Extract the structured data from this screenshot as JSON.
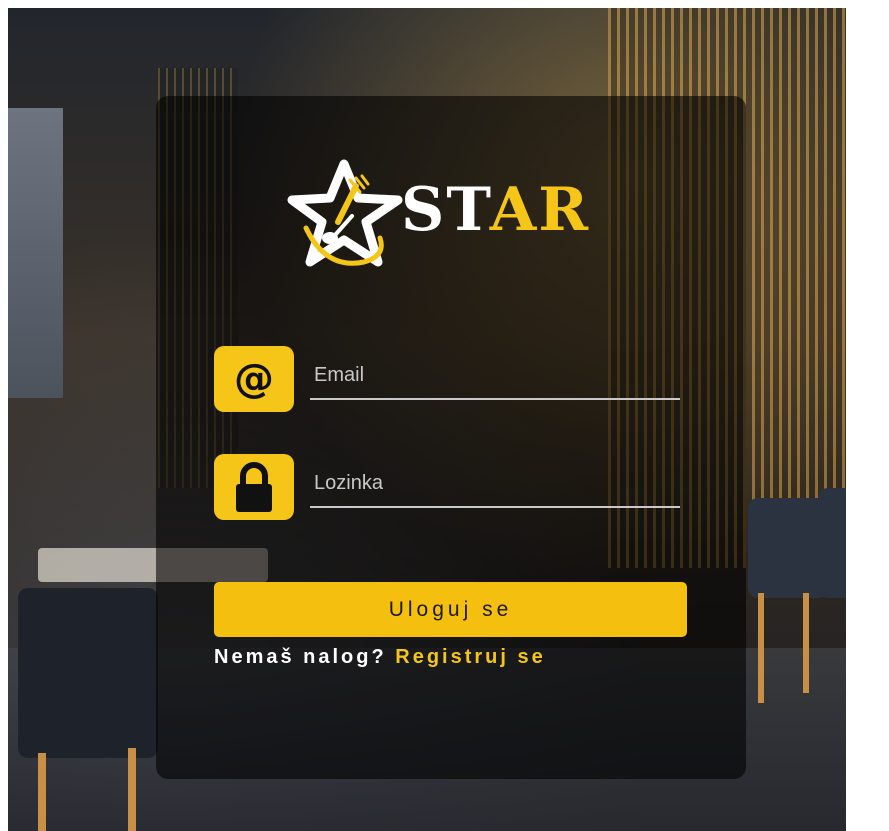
{
  "logo": {
    "text_white": "ST",
    "text_yellow": "A",
    "text_end": "R"
  },
  "form": {
    "email": {
      "placeholder": "Email",
      "value": "",
      "icon": "at-sign-icon"
    },
    "password": {
      "placeholder": "Lozinka",
      "value": "",
      "icon": "lock-icon"
    },
    "submit_label": "Uloguj se"
  },
  "register": {
    "prompt": "Nemaš nalog?",
    "link_label": "Registruj se"
  },
  "colors": {
    "accent": "#f5c518",
    "button": "#f5bf0f",
    "card_bg": "rgba(0,0,0,0.58)"
  }
}
